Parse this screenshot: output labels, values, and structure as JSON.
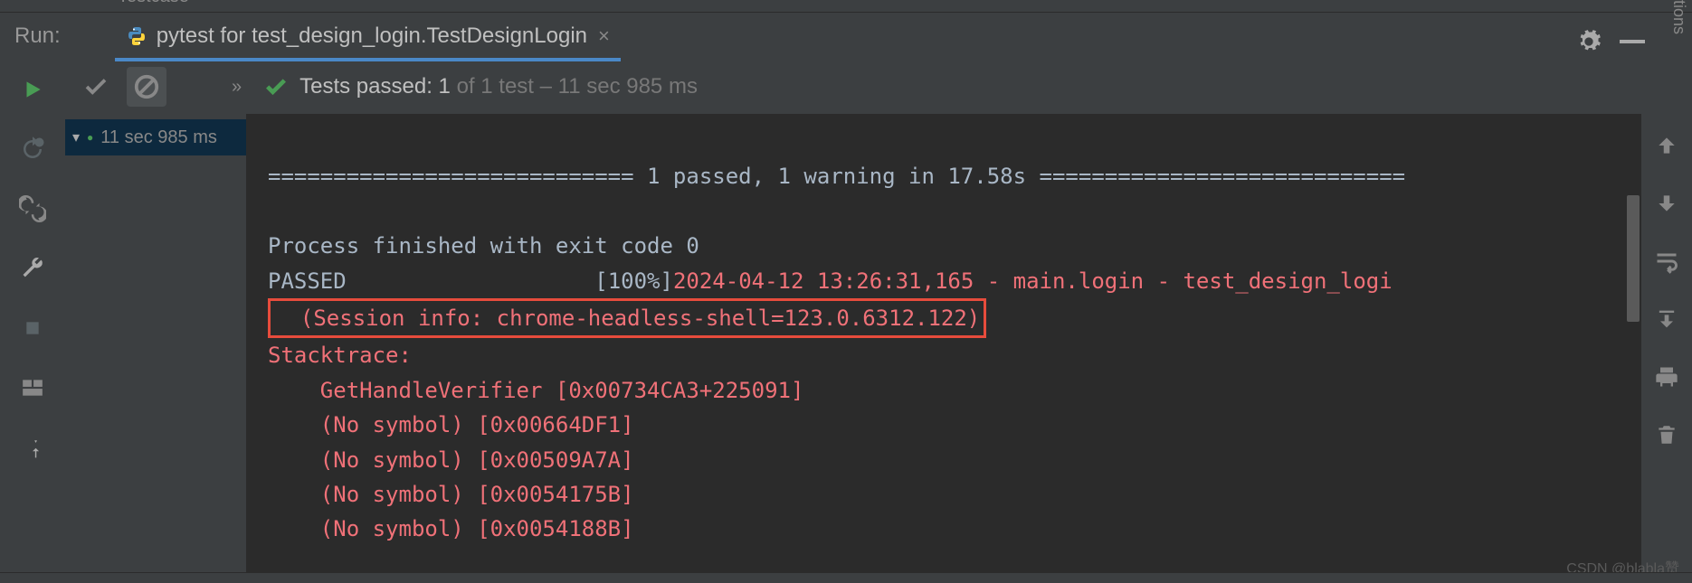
{
  "top_partial_label": "Testcase",
  "run_label": "Run:",
  "tab": {
    "label": "pytest for test_design_login.TestDesignLogin"
  },
  "toolbar": {
    "expand": "»",
    "summary_prefix": "Tests passed: ",
    "summary_count": "1",
    "summary_of": " of 1 test – ",
    "summary_time": "11 sec 985 ms"
  },
  "tree": {
    "root_time": "11 sec 985 ms"
  },
  "console": {
    "divider_l": "============================",
    "summary": " 1 passed, 1 warning in 17.58s ",
    "divider_r": "============================",
    "exit_line": "Process finished with exit code 0",
    "passed_label": "PASSED",
    "passed_pad": "                   ",
    "pct": "[100%]",
    "ts_line": "2024-04-12 13:26:31,165 - main.login - test_design_logi",
    "session_info": "  (Session info: chrome-headless-shell=123.0.6312.122)",
    "stacktrace": "Stacktrace:",
    "st1": "    GetHandleVerifier [0x00734CA3+225091]",
    "st2": "    (No symbol) [0x00664DF1]",
    "st3": "    (No symbol) [0x00509A7A]",
    "st4": "    (No symbol) [0x0054175B]",
    "st5": "    (No symbol) [0x0054188B]"
  },
  "right_text": "tions",
  "watermark": "CSDN @blabla赞"
}
